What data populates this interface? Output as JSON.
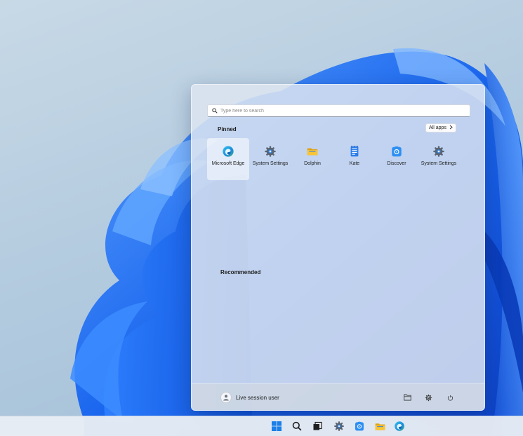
{
  "start_menu": {
    "search_placeholder": "Type here to search",
    "pinned_title": "Pinned",
    "all_apps_label": "All apps",
    "pinned_apps": [
      {
        "label": "Microsoft Edge",
        "icon": "edge-icon",
        "selected": true
      },
      {
        "label": "System Settings",
        "icon": "gear-icon",
        "selected": false
      },
      {
        "label": "Dolphin",
        "icon": "folder-icon",
        "selected": false
      },
      {
        "label": "Kate",
        "icon": "text-editor-icon",
        "selected": false
      },
      {
        "label": "Discover",
        "icon": "store-icon",
        "selected": false
      },
      {
        "label": "System Settings",
        "icon": "gear-icon",
        "selected": false
      }
    ],
    "recommended_title": "Recommended",
    "user_name": "Live session user"
  },
  "taskbar": {
    "items": [
      "start-icon",
      "search-icon",
      "task-view-icon",
      "gear-icon",
      "store-icon",
      "folder-icon",
      "edge-icon"
    ]
  },
  "colors": {
    "accent": "#1a73e8",
    "wallpaper_blue": "#1e6ff0"
  }
}
